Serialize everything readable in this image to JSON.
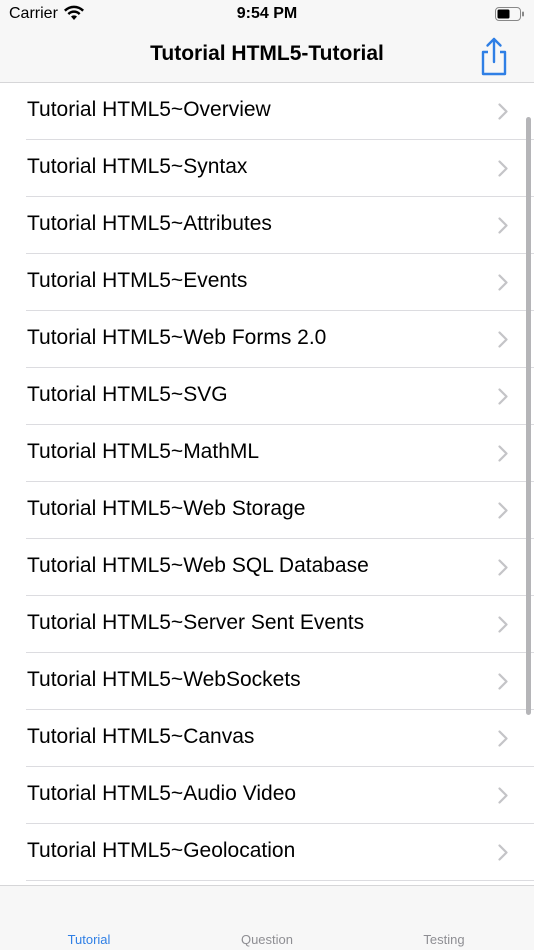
{
  "status": {
    "carrier": "Carrier",
    "time": "9:54 PM"
  },
  "nav": {
    "title": "Tutorial HTML5-Tutorial"
  },
  "list": {
    "items": [
      "Tutorial HTML5~Overview",
      "Tutorial HTML5~Syntax",
      "Tutorial HTML5~Attributes",
      "Tutorial HTML5~Events",
      "Tutorial HTML5~Web Forms 2.0",
      "Tutorial HTML5~SVG",
      "Tutorial HTML5~MathML",
      "Tutorial HTML5~Web Storage",
      "Tutorial HTML5~Web SQL Database",
      "Tutorial HTML5~Server Sent Events",
      "Tutorial HTML5~WebSockets",
      "Tutorial HTML5~Canvas",
      "Tutorial HTML5~Audio Video",
      "Tutorial HTML5~Geolocation"
    ]
  },
  "tabs": [
    {
      "label": "Tutorial",
      "active": true
    },
    {
      "label": "Question",
      "active": false
    },
    {
      "label": "Testing",
      "active": false
    }
  ],
  "colors": {
    "accent": "#2f7fe5",
    "chevron": "#c4c4c7",
    "inactive_tab": "#8e8e93"
  },
  "icons": {
    "share": "share-icon",
    "chevron": "chevron-right-icon",
    "wifi": "wifi-icon",
    "battery": "battery-icon"
  }
}
